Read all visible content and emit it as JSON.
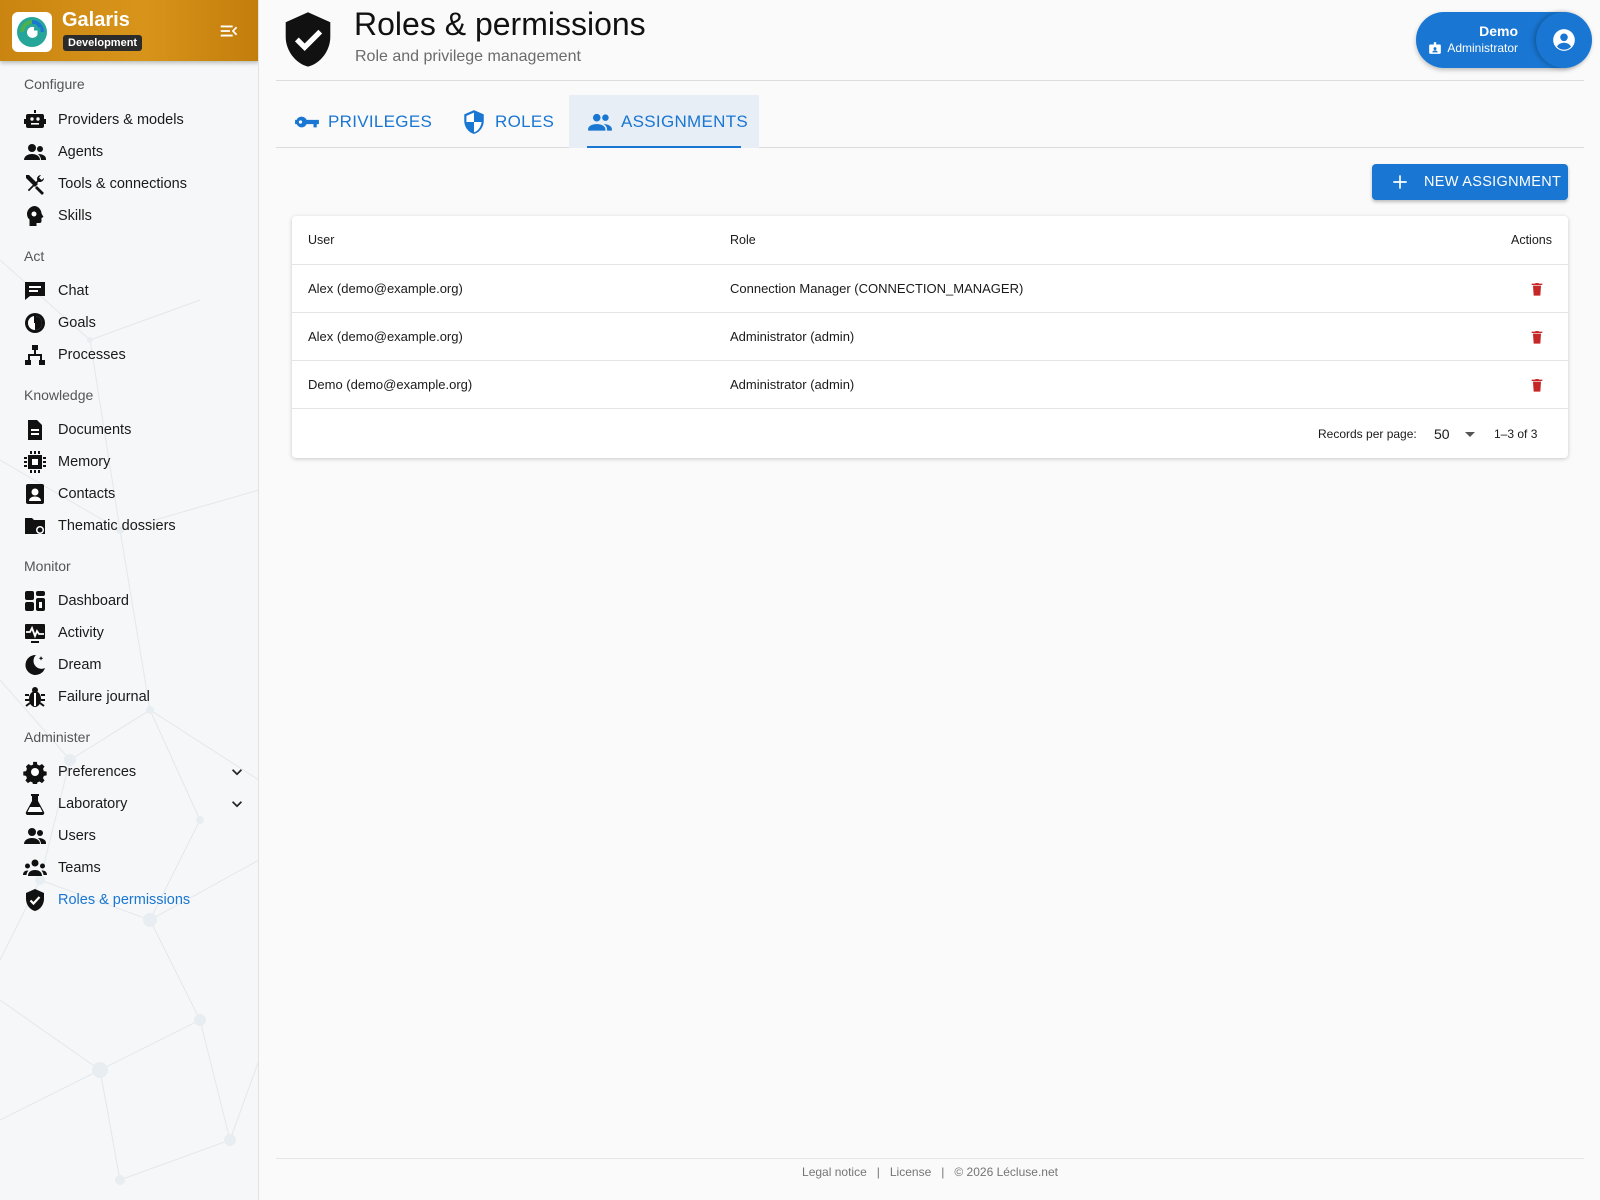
{
  "brand": {
    "name": "Galaris",
    "env_badge": "Development"
  },
  "sidebar": {
    "sections": [
      {
        "title": "Configure",
        "items": [
          {
            "label": "Providers & models",
            "icon": "robot-icon"
          },
          {
            "label": "Agents",
            "icon": "agents-icon"
          },
          {
            "label": "Tools & connections",
            "icon": "tools-icon"
          },
          {
            "label": "Skills",
            "icon": "skills-icon"
          }
        ]
      },
      {
        "title": "Act",
        "items": [
          {
            "label": "Chat",
            "icon": "chat-icon"
          },
          {
            "label": "Goals",
            "icon": "goals-icon"
          },
          {
            "label": "Processes",
            "icon": "processes-icon"
          }
        ]
      },
      {
        "title": "Knowledge",
        "items": [
          {
            "label": "Documents",
            "icon": "document-icon"
          },
          {
            "label": "Memory",
            "icon": "memory-chip-icon"
          },
          {
            "label": "Contacts",
            "icon": "contacts-icon"
          },
          {
            "label": "Thematic dossiers",
            "icon": "folder-icon"
          }
        ]
      },
      {
        "title": "Monitor",
        "items": [
          {
            "label": "Dashboard",
            "icon": "dashboard-icon"
          },
          {
            "label": "Activity",
            "icon": "activity-icon"
          },
          {
            "label": "Dream",
            "icon": "moon-icon"
          },
          {
            "label": "Failure journal",
            "icon": "bug-icon"
          }
        ]
      },
      {
        "title": "Administer",
        "items": [
          {
            "label": "Preferences",
            "icon": "gear-icon",
            "expandable": true
          },
          {
            "label": "Laboratory",
            "icon": "flask-icon",
            "expandable": true
          },
          {
            "label": "Users",
            "icon": "users-icon"
          },
          {
            "label": "Teams",
            "icon": "teams-icon"
          },
          {
            "label": "Roles & permissions",
            "icon": "shield-check-icon",
            "active": true
          }
        ]
      }
    ]
  },
  "header": {
    "title": "Roles & permissions",
    "subtitle": "Role and privilege management",
    "icon": "shield-check-icon"
  },
  "user": {
    "name": "Demo",
    "role": "Administrator"
  },
  "tabs": [
    {
      "label": "PRIVILEGES",
      "icon": "key-icon"
    },
    {
      "label": "ROLES",
      "icon": "shield-icon"
    },
    {
      "label": "ASSIGNMENTS",
      "icon": "people-icon",
      "active": true
    }
  ],
  "actions": {
    "new_assignment": "NEW ASSIGNMENT"
  },
  "table": {
    "columns": [
      "User",
      "Role",
      "Actions"
    ],
    "rows": [
      {
        "user": "Alex (demo@example.org)",
        "role": "Connection Manager (CONNECTION_MANAGER)"
      },
      {
        "user": "Alex (demo@example.org)",
        "role": "Administrator (admin)"
      },
      {
        "user": "Demo (demo@example.org)",
        "role": "Administrator (admin)"
      }
    ],
    "records_per_page_label": "Records per page:",
    "records_per_page": "50",
    "range": "1–3 of 3"
  },
  "footer": {
    "legal": "Legal notice",
    "license": "License",
    "copyright": "© 2026 Lécluse.net"
  },
  "colors": {
    "accent": "#1976d2",
    "brand": "#c98510",
    "danger": "#c62828"
  }
}
